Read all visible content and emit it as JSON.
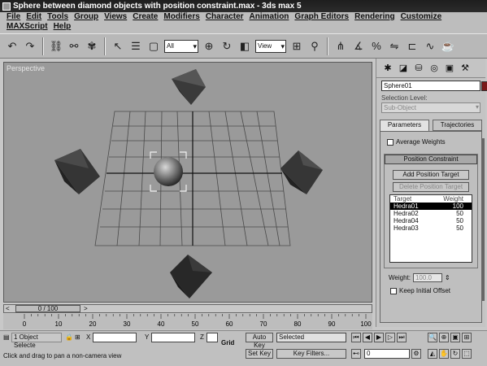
{
  "window": {
    "title": "Sphere between diamond objects with position constraint.max - 3ds max 5"
  },
  "menu": [
    "File",
    "Edit",
    "Tools",
    "Group",
    "Views",
    "Create",
    "Modifiers",
    "Character",
    "Animation",
    "Graph Editors",
    "Rendering",
    "Customize",
    "MAXScript",
    "Help"
  ],
  "toolbar": {
    "selection_filter": "All",
    "reference_coord": "View"
  },
  "viewport": {
    "label": "Perspective"
  },
  "command_panel": {
    "object_name": "Sphere01",
    "object_color": "#7a1a1a",
    "selection_level_label": "Selection Level:",
    "selection_level_value": "Sub-Object",
    "tab_parameters": "Parameters",
    "tab_trajectories": "Trajectories",
    "average_weights": "Average Weights",
    "rollout_title": "Position Constraint",
    "add_target": "Add Position Target",
    "delete_target": "Delete Position Target",
    "list_header_target": "Target",
    "list_header_weight": "Weight",
    "targets": [
      {
        "name": "Hedra01",
        "weight": "100"
      },
      {
        "name": "Hedra02",
        "weight": "50"
      },
      {
        "name": "Hedra04",
        "weight": "50"
      },
      {
        "name": "Hedra03",
        "weight": "50"
      }
    ],
    "weight_label": "Weight:",
    "weight_value": "100.0",
    "keep_offset": "Keep Initial Offset"
  },
  "timeline": {
    "frame_display": "0 / 100",
    "ticks": [
      "0",
      "10",
      "20",
      "30",
      "40",
      "50",
      "60",
      "70",
      "80",
      "90",
      "100"
    ]
  },
  "status": {
    "selection": "1 Object Selecte",
    "prompt": "Click and drag to pan a non-camera view",
    "x_label": "X",
    "y_label": "Y",
    "z_label": "Z",
    "grid_label": "Grid",
    "auto_key": "Auto Key",
    "set_key": "Set Key",
    "selected_set": "Selected",
    "key_filters": "Key Filters...",
    "frame": "0"
  }
}
